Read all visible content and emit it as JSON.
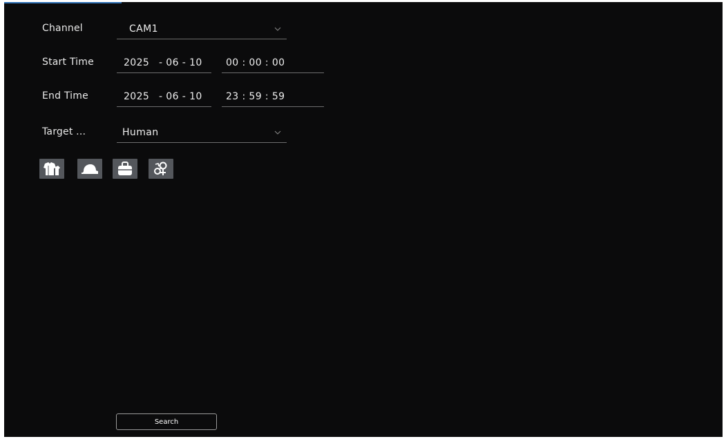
{
  "form": {
    "channel": {
      "label": "Channel",
      "value": "CAM1"
    },
    "start_time": {
      "label": "Start Time",
      "date": {
        "year": "2025",
        "sep1": "- 06 - 10"
      },
      "time": "00 : 00 : 00"
    },
    "end_time": {
      "label": "End Time",
      "date": {
        "year": "2025",
        "sep1": "- 06 - 10"
      },
      "time": "23 : 59 : 59"
    },
    "target": {
      "label": "Target ...",
      "value": "Human"
    },
    "attribute_icons": [
      "clothing-icon",
      "hat-icon",
      "bag-icon",
      "gender-icon"
    ]
  },
  "actions": {
    "search_label": "Search"
  },
  "colors": {
    "background": "#0b0b0c",
    "icon_button": "#54575c",
    "accent": "#2d6fb3",
    "text": "#efefef"
  }
}
